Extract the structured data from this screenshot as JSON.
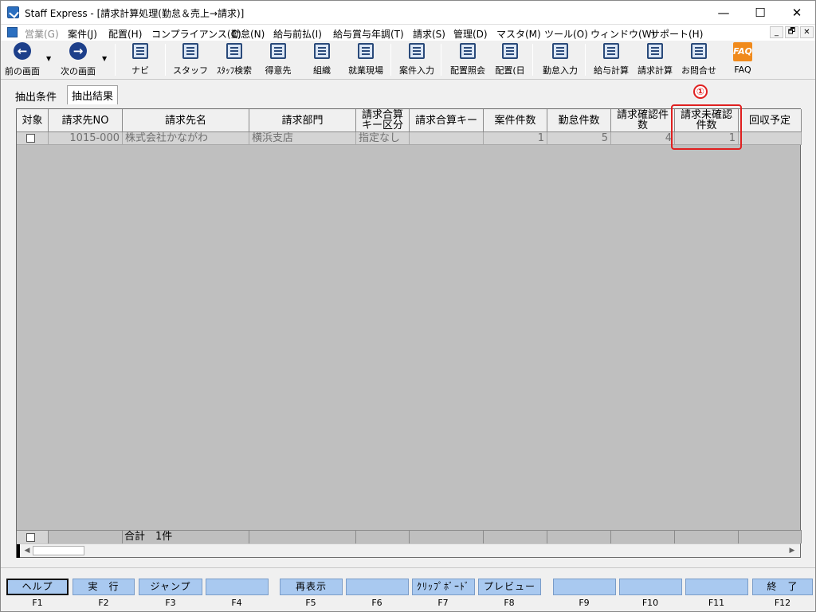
{
  "window": {
    "title": "Staff Express - [請求計算処理(勤怠＆売上→請求)]",
    "minimize": "—",
    "maximize": "☐",
    "close": "✕"
  },
  "menu": [
    {
      "label": "営業(G)",
      "disabled": true
    },
    {
      "label": "案件(J)"
    },
    {
      "label": "配置(H)"
    },
    {
      "label": "コンプライアンス(C)"
    },
    {
      "label": "勤怠(N)"
    },
    {
      "label": "給与前払(I)"
    },
    {
      "label": "給与賞与年調(T)"
    },
    {
      "label": "請求(S)"
    },
    {
      "label": "管理(D)"
    },
    {
      "label": "マスタ(M)"
    },
    {
      "label": "ツール(O)"
    },
    {
      "label": "ウィンドウ(W)"
    },
    {
      "label": "サポート(H)"
    }
  ],
  "mdi": {
    "minimize": "_",
    "restore": "🗗",
    "close": "✕"
  },
  "toolbar": [
    {
      "label": "前の画面",
      "icon": "back-arrow-icon"
    },
    {
      "label": "次の画面",
      "icon": "forward-arrow-icon"
    },
    {
      "label": "ナビ",
      "icon": "navi-icon"
    },
    {
      "label": "スタッフ",
      "icon": "staff-icon"
    },
    {
      "label": "ｽﾀｯﾌ検索",
      "icon": "staff-search-icon"
    },
    {
      "label": "得意先",
      "icon": "customer-icon"
    },
    {
      "label": "組織",
      "icon": "organization-icon"
    },
    {
      "label": "就業現場",
      "icon": "worksite-icon"
    },
    {
      "label": "案件入力",
      "icon": "case-entry-icon"
    },
    {
      "label": "配置照会",
      "icon": "placement-inquiry-icon"
    },
    {
      "label": "配置(日",
      "icon": "placement-daily-icon"
    },
    {
      "label": "勤怠入力",
      "icon": "attendance-entry-icon"
    },
    {
      "label": "給与計算",
      "icon": "payroll-calc-icon"
    },
    {
      "label": "請求計算",
      "icon": "billing-calc-icon"
    },
    {
      "label": "お問合せ",
      "icon": "inquiry-icon"
    },
    {
      "label": "FAQ",
      "icon": "faq-icon",
      "icon_text": "FAQ"
    }
  ],
  "tabs": [
    {
      "label": "抽出条件"
    },
    {
      "label": "抽出結果",
      "active": true
    }
  ],
  "grid": {
    "columns": [
      "対象",
      "請求先NO",
      "請求先名",
      "請求部門",
      "請求合算\nキー区分",
      "請求合算キー",
      "案件件数",
      "勤怠件数",
      "請求確認件\n数",
      "請求未確認\n件数",
      "回収予定"
    ],
    "rows": [
      {
        "checked": false,
        "client_no": "1015-000",
        "client_name": "株式会社かながわ",
        "department": "横浜支店",
        "merge_key_type": "指定なし",
        "merge_key": "",
        "case_count": "1",
        "attendance_count": "5",
        "confirmed_count": "4",
        "unconfirmed_count": "1",
        "collection_date": ""
      }
    ],
    "footer_total": "合計　1件"
  },
  "annotation": {
    "badge": "①"
  },
  "function_keys": [
    {
      "key": "F1",
      "label": "ヘルプ"
    },
    {
      "key": "F2",
      "label": "実　行"
    },
    {
      "key": "F3",
      "label": "ジャンプ"
    },
    {
      "key": "F4",
      "label": ""
    },
    {
      "key": "F5",
      "label": "再表示"
    },
    {
      "key": "F6",
      "label": ""
    },
    {
      "key": "F7",
      "label": "ｸﾘｯﾌﾟﾎﾞｰﾄﾞ"
    },
    {
      "key": "F8",
      "label": "プレビュー"
    },
    {
      "key": "F9",
      "label": ""
    },
    {
      "key": "F10",
      "label": ""
    },
    {
      "key": "F11",
      "label": ""
    },
    {
      "key": "F12",
      "label": "終　了"
    }
  ],
  "colors": {
    "fkey_bg": "#a9c9f0",
    "highlight": "#e02020",
    "grid_bg": "#bfbfbf"
  }
}
